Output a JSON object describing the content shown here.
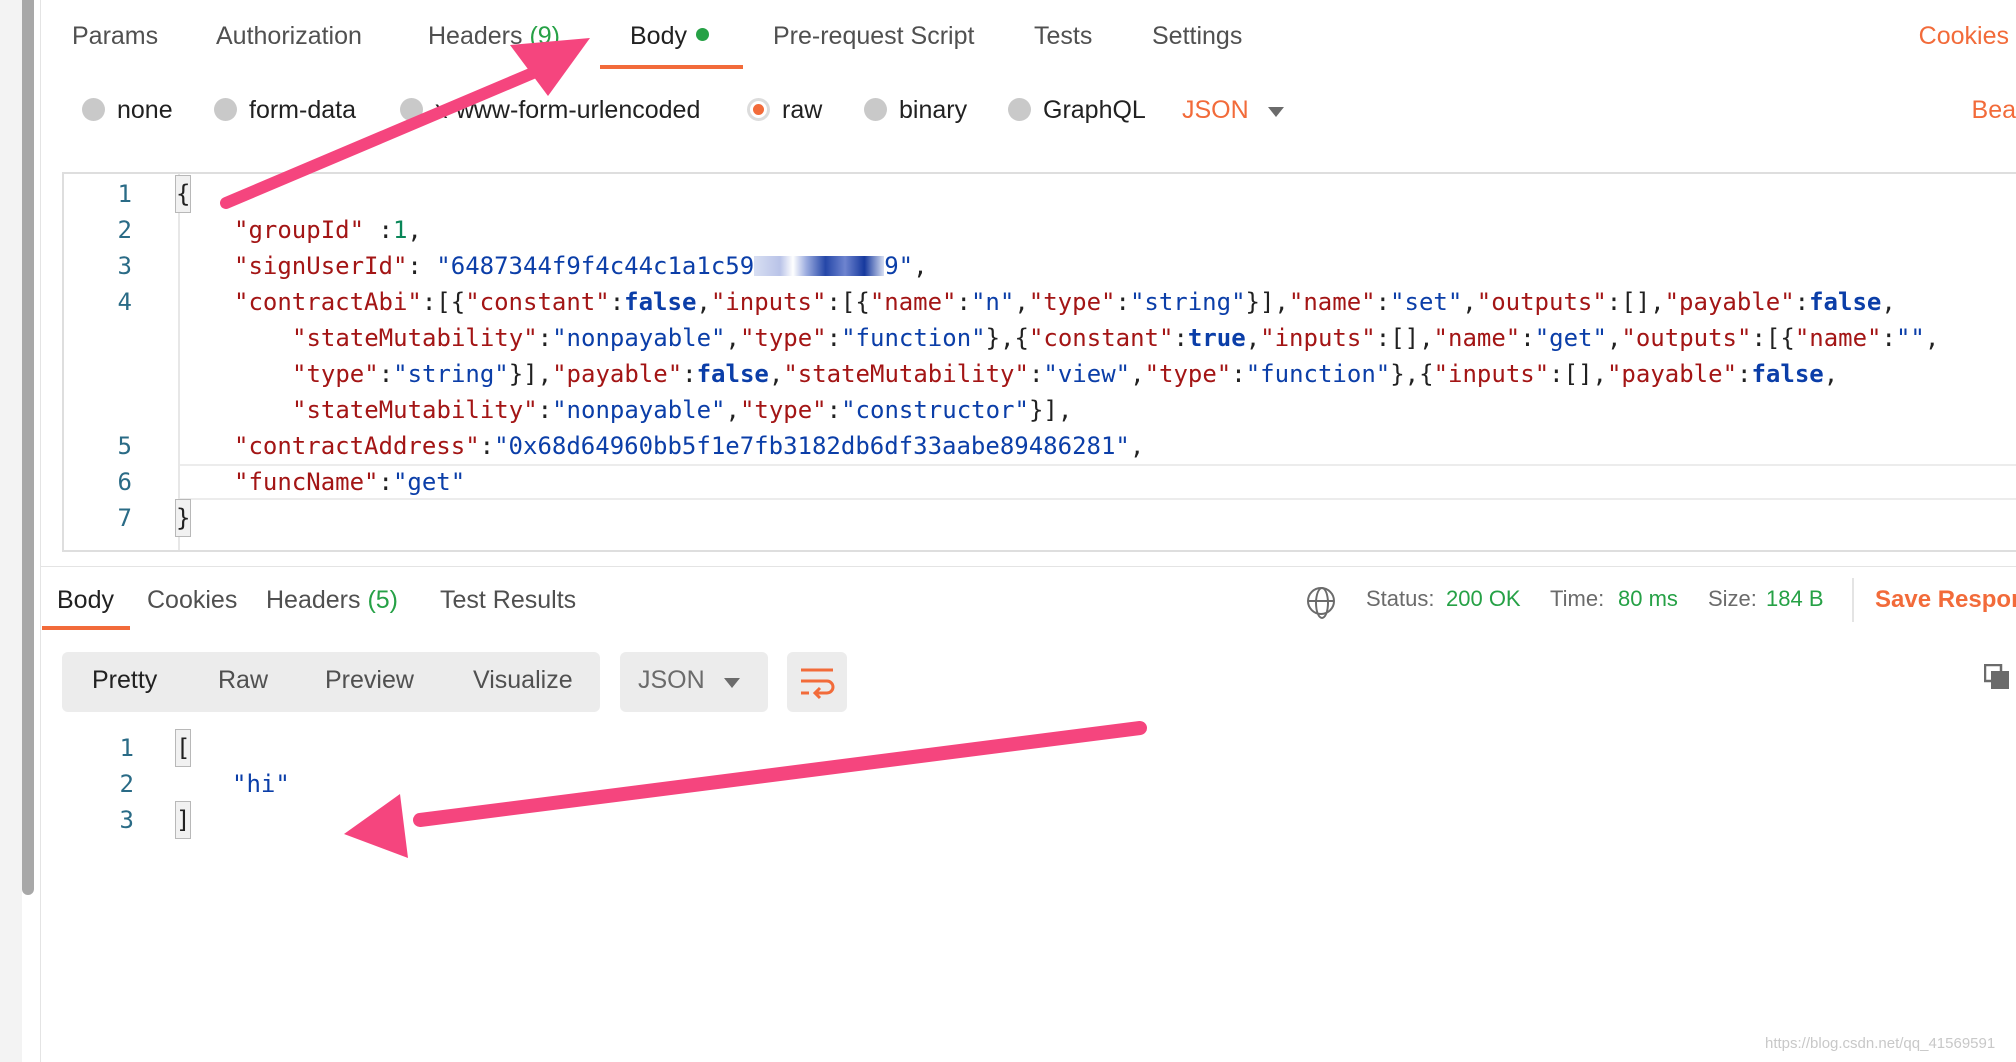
{
  "request_tabs": {
    "params": "Params",
    "authorization": "Authorization",
    "headers": "Headers",
    "headers_count": "(9)",
    "body": "Body",
    "prerequest": "Pre-request Script",
    "tests": "Tests",
    "settings": "Settings",
    "cookies": "Cookies"
  },
  "body_modes": {
    "none": "none",
    "form_data": "form-data",
    "urlencoded": "x-www-form-urlencoded",
    "raw": "raw",
    "binary": "binary",
    "graphql": "GraphQL",
    "format": "JSON",
    "beautify": "Bea"
  },
  "request_body": {
    "line_numbers": [
      "1",
      "2",
      "3",
      "4",
      "5",
      "6",
      "7"
    ],
    "open_brace": "{",
    "close_brace": "}",
    "group_id_key": "\"groupId\"",
    "group_id_value": "1",
    "sign_user_id_key": "\"signUserId\"",
    "sign_user_id_value": "\"6487344f9f4c44c1a1c59",
    "sign_user_id_tail": "9\"",
    "contract_abi_key": "\"contractAbi\"",
    "contract_address_key": "\"contractAddress\"",
    "contract_address_value": "\"0x68d64960bb5f1e7fb3182db6df33aabe89486281\"",
    "func_name_key": "\"funcName\"",
    "func_name_value": "\"get\""
  },
  "response_tabs": {
    "body": "Body",
    "cookies": "Cookies",
    "headers": "Headers",
    "headers_count": "(5)",
    "test_results": "Test Results"
  },
  "response_status": {
    "status_label": "Status:",
    "status_value": "200 OK",
    "time_label": "Time:",
    "time_value": "80 ms",
    "size_label": "Size:",
    "size_value": "184 B",
    "save_response": "Save Respon"
  },
  "response_view": {
    "pretty": "Pretty",
    "raw": "Raw",
    "preview": "Preview",
    "visualize": "Visualize",
    "format": "JSON"
  },
  "response_body": {
    "line_numbers": [
      "1",
      "2",
      "3"
    ],
    "open_bracket": "[",
    "value": "\"hi\"",
    "close_bracket": "]"
  },
  "watermark": "https://blog.csdn.net/qq_41569591",
  "colors": {
    "accent": "#f26b3a",
    "success": "#26a146",
    "annotation_arrow": "#f5457e",
    "json_key": "#a31515",
    "json_string": "#0b3ea8"
  }
}
